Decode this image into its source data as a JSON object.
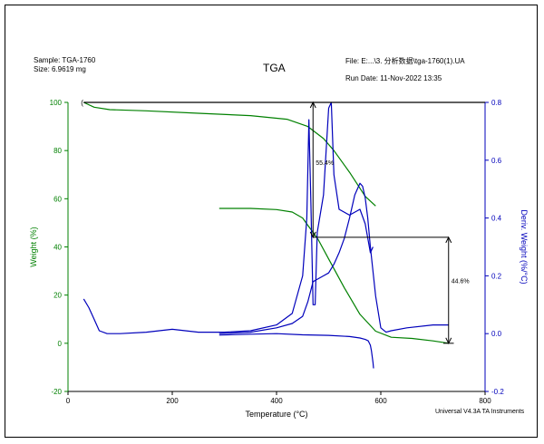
{
  "header": {
    "sample": "Sample: TGA-1760",
    "size": "Size:  6.9619 mg",
    "file": "File: E:...\\3. 分析数据\\tga-1760(1).UA",
    "run_date": "Run Date: 11-Nov-2022 13:35",
    "footer": "Universal V4.3A TA Instruments"
  },
  "chart_data": {
    "type": "line",
    "title": "TGA",
    "xlabel": "Temperature (°C)",
    "ylabel": "Weight (%)",
    "y2label": "Deriv. Weight (%/°C)",
    "xlim": [
      0,
      800
    ],
    "ylim": [
      -20,
      100
    ],
    "y2lim": [
      -0.2,
      0.8
    ],
    "xticks": [
      0,
      200,
      400,
      600,
      800
    ],
    "yticks": [
      -20,
      0,
      20,
      40,
      60,
      80,
      100
    ],
    "y2ticks": [
      -0.2,
      0.0,
      0.2,
      0.4,
      0.6,
      0.8
    ],
    "y2ticklabels": [
      "-0.2",
      "0.0",
      "0.2",
      "0.4",
      "0.6",
      "0.8"
    ],
    "colors": {
      "weight": "#008000",
      "deriv": "#0000bb",
      "axis_left": "#008000",
      "axis_right": "#0000bb",
      "annotation": "#000000"
    },
    "series": [
      {
        "axis": "left",
        "color": "#008000",
        "x": [
          30,
          50,
          80,
          150,
          250,
          350,
          420,
          460,
          490,
          510,
          540,
          570,
          590
        ],
        "values": [
          100,
          98,
          97,
          96.5,
          95.5,
          94.5,
          93,
          90,
          85,
          80,
          71,
          61,
          57
        ]
      },
      {
        "axis": "left",
        "color": "#008000",
        "x": [
          290,
          350,
          400,
          430,
          450,
          460,
          470,
          480,
          500,
          530,
          560,
          590,
          620,
          660,
          700,
          730
        ],
        "values": [
          56,
          56,
          55.5,
          54.5,
          52,
          49,
          46,
          43,
          35,
          23,
          12,
          5,
          2.5,
          2,
          1,
          0
        ]
      },
      {
        "axis": "right",
        "color": "#0000bb",
        "x": [
          30,
          40,
          50,
          60,
          75,
          100,
          150,
          200,
          250,
          300,
          350,
          400,
          430,
          450,
          458,
          462,
          466,
          470,
          474,
          478,
          490,
          500,
          505,
          510,
          520,
          540,
          560,
          570,
          580,
          585
        ],
        "values": [
          0.12,
          0.09,
          0.05,
          0.01,
          0.0,
          0.0,
          0.005,
          0.015,
          0.005,
          0.005,
          0.01,
          0.03,
          0.07,
          0.2,
          0.4,
          0.74,
          0.45,
          0.1,
          0.1,
          0.35,
          0.48,
          0.78,
          0.8,
          0.55,
          0.43,
          0.41,
          0.43,
          0.38,
          0.28,
          0.3
        ]
      },
      {
        "axis": "right",
        "color": "#0000bb",
        "x": [
          290,
          350,
          400,
          430,
          450,
          460,
          470,
          480,
          490,
          500,
          510,
          520,
          530,
          540,
          550,
          560,
          565,
          570,
          575,
          580,
          590,
          600,
          610,
          620,
          650,
          700,
          730
        ],
        "values": [
          0.0,
          0.005,
          0.02,
          0.035,
          0.06,
          0.11,
          0.18,
          0.19,
          0.2,
          0.21,
          0.24,
          0.28,
          0.33,
          0.4,
          0.48,
          0.52,
          0.51,
          0.47,
          0.4,
          0.3,
          0.13,
          0.02,
          0.005,
          0.01,
          0.02,
          0.03,
          0.03
        ]
      },
      {
        "axis": "right",
        "color": "#0000bb",
        "x": [
          290,
          350,
          400,
          450,
          500,
          540,
          560,
          570,
          576,
          580,
          582,
          585,
          586
        ],
        "values": [
          -0.005,
          -0.002,
          0.0,
          -0.004,
          -0.006,
          -0.01,
          -0.015,
          -0.02,
          -0.025,
          -0.04,
          -0.06,
          -0.1,
          -0.12
        ]
      }
    ],
    "annotations": [
      {
        "label": "55.4%",
        "x": 470,
        "y_top": 100,
        "y_bottom": 44,
        "label_at": 74,
        "text_side": "right"
      },
      {
        "label": "44.6%",
        "x": 730,
        "y_top": 44,
        "y_bottom": 0,
        "label_at": 25,
        "text_side": "right"
      }
    ]
  }
}
